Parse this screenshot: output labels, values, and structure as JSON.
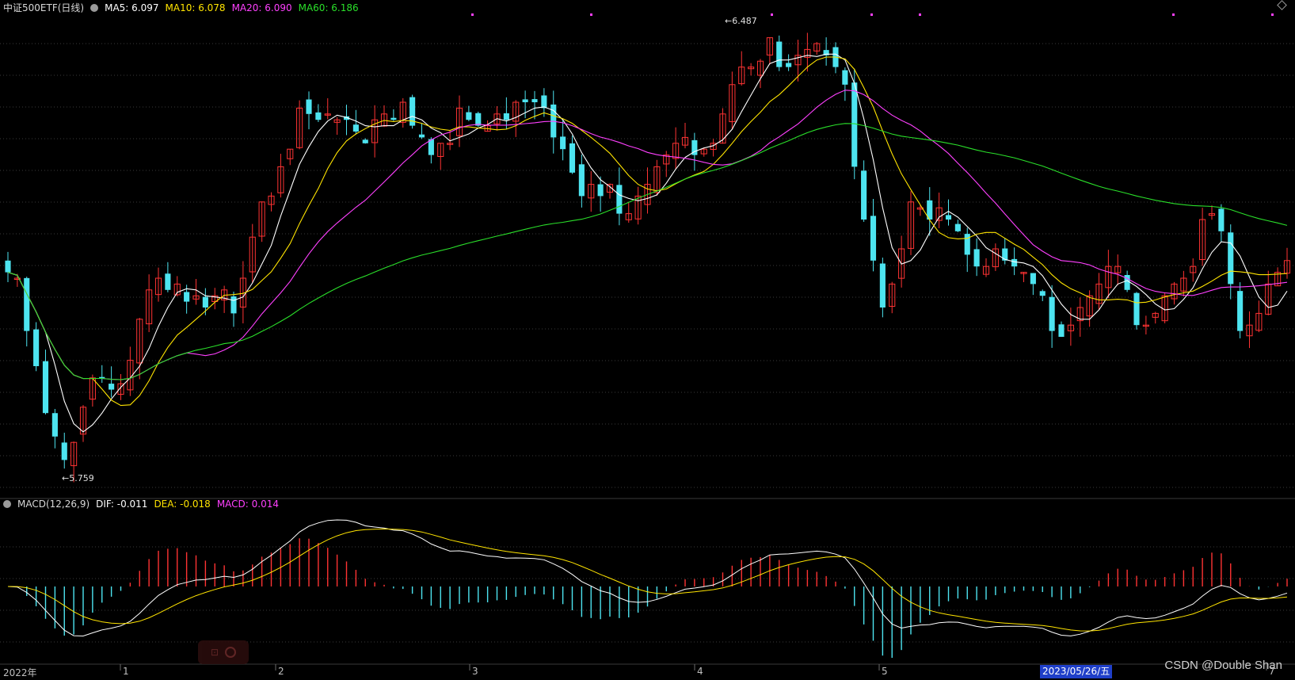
{
  "top_legend": {
    "title": "中证500ETF(日线)",
    "ma5": "MA5: 6.097",
    "ma10": "MA10: 6.078",
    "ma20": "MA20: 6.090",
    "ma60": "MA60: 6.186"
  },
  "macd_legend": {
    "title": "MACD(12,26,9)",
    "dif": "DIF: -0.011",
    "dea": "DEA: -0.018",
    "macd": "MACD: 0.014"
  },
  "annotations": {
    "high": "←6.487",
    "low": "←5.759"
  },
  "x_axis": {
    "year": "2022年",
    "m1": "1",
    "m2": "2",
    "m3": "3",
    "m4": "4",
    "m5": "5",
    "m7": "7"
  },
  "selected_date": "2023/05/26/五",
  "watermark": "CSDN @Double Shan",
  "colors": {
    "up": "#ff3333",
    "down": "#4de4f0",
    "ma5": "#ffffff",
    "ma10": "#ffe400",
    "ma20": "#ff40ff",
    "ma60": "#2adf2a",
    "dif": "#ffffff",
    "dea": "#ffe400"
  },
  "chart_data": {
    "type": "candlestick",
    "price_high": 6.487,
    "price_low": 5.759,
    "series": [
      {
        "name": "MA5",
        "value": 6.097
      },
      {
        "name": "MA10",
        "value": 6.078
      },
      {
        "name": "MA20",
        "value": 6.09
      },
      {
        "name": "MA60",
        "value": 6.186
      }
    ],
    "macd": {
      "params": "12,26,9",
      "dif": -0.011,
      "dea": -0.018,
      "macd": 0.014
    },
    "close": [
      6.08,
      6.07,
      5.98,
      5.92,
      5.84,
      5.8,
      5.76,
      5.79,
      5.85,
      5.9,
      5.9,
      5.88,
      5.89,
      5.93,
      6.0,
      6.05,
      6.07,
      6.05,
      6.06,
      6.03,
      6.04,
      6.02,
      6.04,
      6.05,
      6.01,
      6.07,
      6.14,
      6.2,
      6.21,
      6.26,
      6.29,
      6.36,
      6.35,
      6.34,
      6.35,
      6.34,
      6.34,
      6.32,
      6.3,
      6.34,
      6.35,
      6.34,
      6.37,
      6.33,
      6.31,
      6.28,
      6.3,
      6.3,
      6.36,
      6.34,
      6.33,
      6.33,
      6.35,
      6.34,
      6.37,
      6.37,
      6.37,
      6.36,
      6.31,
      6.29,
      6.25,
      6.21,
      6.23,
      6.21,
      6.23,
      6.18,
      6.18,
      6.21,
      6.23,
      6.26,
      6.28,
      6.3,
      6.31,
      6.28,
      6.29,
      6.3,
      6.35,
      6.4,
      6.43,
      6.43,
      6.44,
      6.48,
      6.43,
      6.43,
      6.45,
      6.46,
      6.47,
      6.45,
      6.43,
      6.4,
      6.26,
      6.17,
      6.1,
      6.02,
      6.06,
      6.12,
      6.2,
      6.19,
      6.17,
      6.19,
      6.17,
      6.15,
      6.11,
      6.09,
      6.09,
      6.12,
      6.1,
      6.09,
      6.08,
      6.06,
      6.04,
      5.98,
      5.97,
      5.99,
      6.02,
      6.04,
      6.06,
      6.09,
      6.09,
      6.05,
      5.99,
      5.99,
      6.01,
      6.04,
      6.06,
      6.07,
      6.09,
      6.17,
      6.18,
      6.15,
      6.06,
      5.98,
      5.99,
      6.01,
      6.06,
      6.08,
      6.1
    ]
  }
}
